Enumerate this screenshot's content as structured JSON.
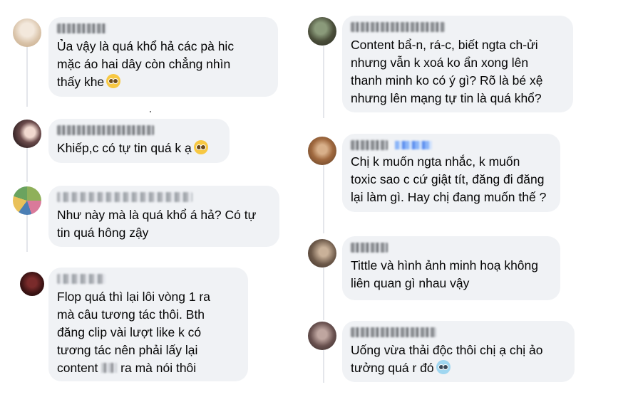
{
  "left_column": [
    {
      "id": "c1",
      "text": "Ủa vậy là quá khổ hả các pà hic\nmặc áo hai dây còn chẳng nhìn\nthấy khe",
      "emoji": "pleading-face-icon"
    },
    {
      "id": "c2",
      "text": "Khiếp,c có tự tin quá k ạ",
      "emoji": "pleading-face-icon"
    },
    {
      "id": "c3",
      "text": "Như này mà là quá khổ á hả? Có tự\ntin quá hông zậy"
    },
    {
      "id": "c4",
      "text_before": "Flop quá thì lại lôi vòng 1 ra\nmà câu tương tác thôi. Bth\nđăng clip vài lượt like k có\ntương tác nên phải lấy lại\ncontent ",
      "text_after": " ra mà nói thôi"
    }
  ],
  "right_column": [
    {
      "id": "c5",
      "text": "Content bẩ-n, rá-c, biết ngta ch-ửi\nnhưng vẫn k xoá ko ẩn xong lên\nthanh minh ko có ý gì? Rõ là bé xệ\nnhưng lên mạng tự tin là quá khổ?"
    },
    {
      "id": "c6",
      "text": "Chị k muốn ngta nhắc, k muốn\ntoxic sao c cứ giật tít, đăng đi đăng\nlại làm gì. Hay chị đang muốn thế ?"
    },
    {
      "id": "c7",
      "text": "Tittle và hình ảnh minh hoạ không\nliên quan gì nhau vậy"
    },
    {
      "id": "c8",
      "text": "Uống vừa thải độc thôi chị ạ chị ảo\ntưởng quá r đó",
      "emoji": "cold-face-icon"
    }
  ],
  "colors": {
    "bubble": "#f0f2f5",
    "text": "#050505",
    "thread_line": "#e4e6eb"
  }
}
